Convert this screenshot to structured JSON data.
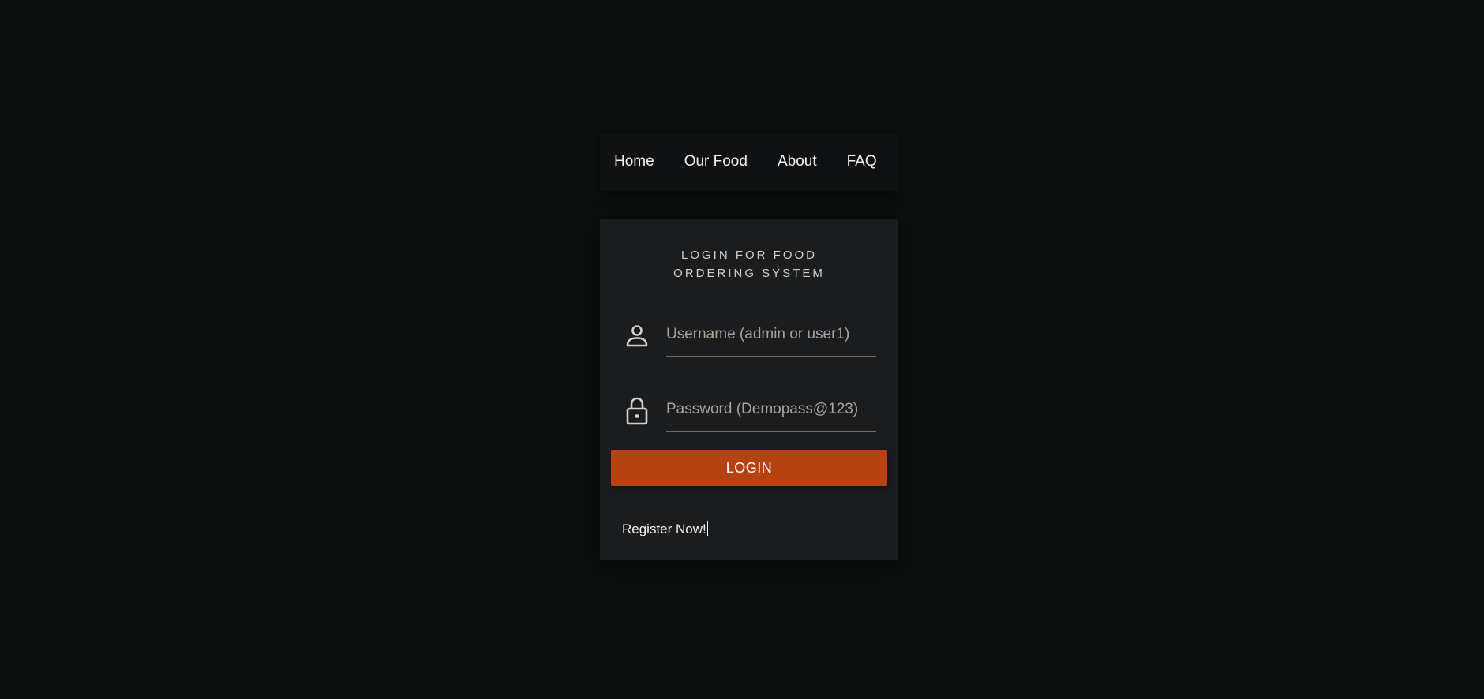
{
  "nav": {
    "items": [
      {
        "label": "Home"
      },
      {
        "label": "Our Food"
      },
      {
        "label": "About"
      },
      {
        "label": "FAQ"
      }
    ]
  },
  "login": {
    "title": "LOGIN FOR FOOD ORDERING SYSTEM",
    "username": {
      "value": "",
      "placeholder": "Username (admin or user1)",
      "icon": "person-icon"
    },
    "password": {
      "value": "",
      "placeholder": "Password (Demopass@123)",
      "icon": "lock-icon"
    },
    "button_label": "LOGIN",
    "register_label": "Register Now!"
  },
  "colors": {
    "background": "#0d0f0f",
    "card": "#1b1c1e",
    "accent": "#b64212",
    "placeholder": "#a9a39a"
  }
}
